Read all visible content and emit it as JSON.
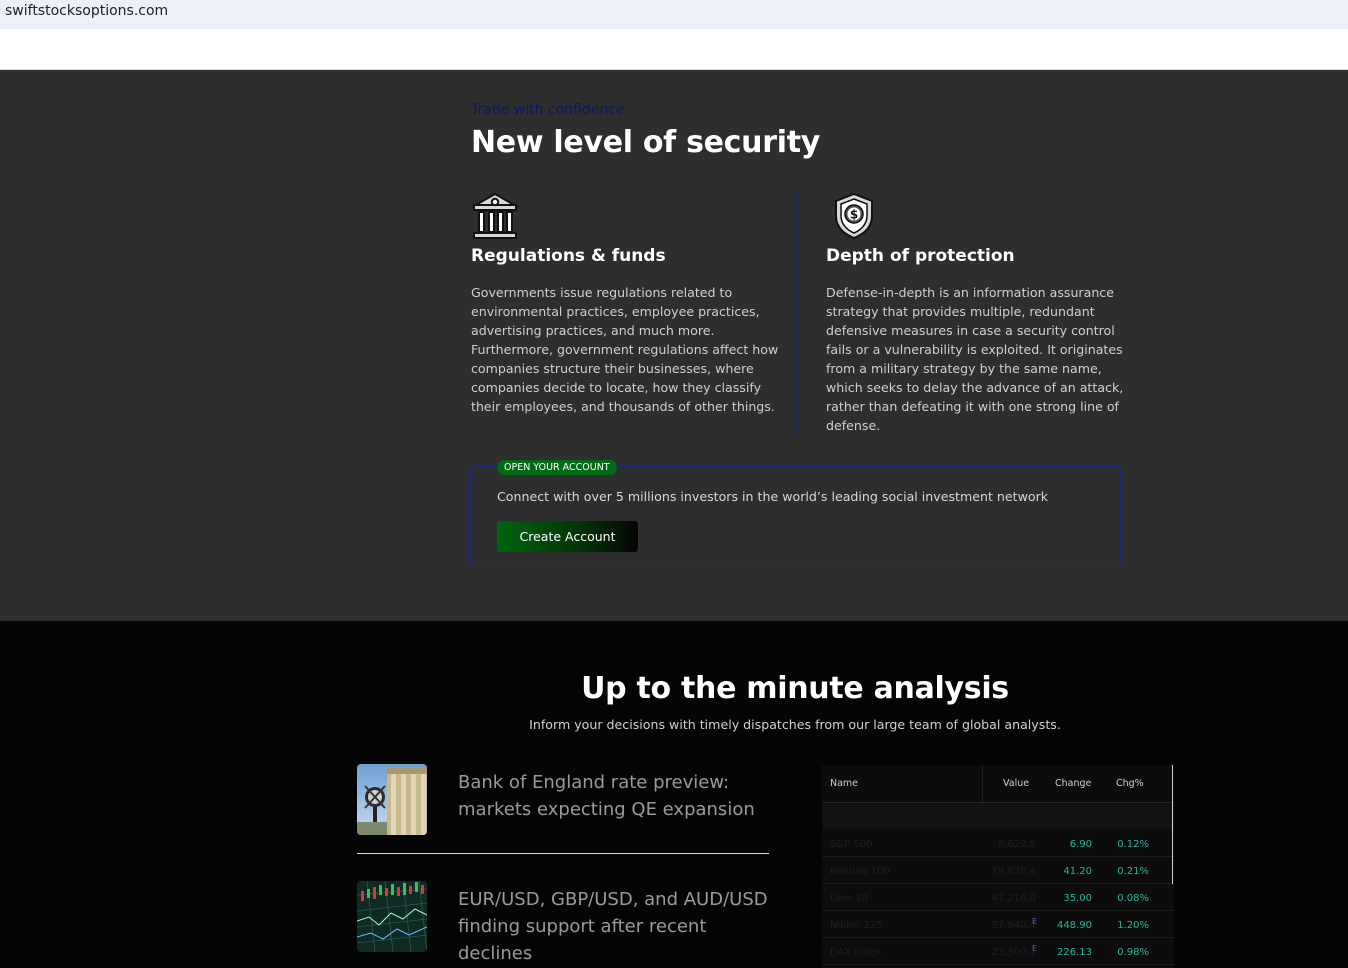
{
  "browser": {
    "url": "swiftstocksoptions.com"
  },
  "security": {
    "eyebrow": "Trade with confidence",
    "title": "New level of security",
    "features": [
      {
        "icon": "bank-building-icon",
        "title": "Regulations & funds",
        "text": "Governments issue regulations related to environmental practices, employee practices, advertising practices, and much more. Furthermore, government regulations affect how companies structure their businesses, where companies decide to locate, how they classify their employees, and thousands of other things."
      },
      {
        "icon": "shield-dollar-icon",
        "title": "Depth of protection",
        "text": "Defense-in-depth is an information assurance strategy that provides multiple, redundant defensive measures in case a security control fails or a vulnerability is exploited. It originates from a military strategy by the same name, which seeks to delay the advance of an attack, rather than defeating it with one strong line of defense."
      }
    ],
    "account": {
      "pill": "OPEN YOUR ACCOUNT",
      "text": "Connect with over 5 millions investors in the world’s leading social investment network",
      "button": "Create Account"
    }
  },
  "analysis": {
    "title": "Up to the minute analysis",
    "subtitle": "Inform your decisions with timely dispatches from our large team of global analysts.",
    "news": [
      {
        "title": "Bank of England rate preview: markets expecting QE expansion",
        "thumb": "bank-of-england-photo"
      },
      {
        "title": "EUR/USD, GBP/USD, and AUD/USD finding support after recent declines",
        "thumb": "forex-chart-photo"
      }
    ],
    "ticker": {
      "headers": {
        "name": "Name",
        "value": "Value",
        "change": "Change",
        "chg_pct": "Chg%"
      },
      "rows": [
        {
          "name": "S&P 500",
          "value": "5,622.5",
          "change": "6.90",
          "chg_pct": "0.12%",
          "marker": ""
        },
        {
          "name": "Nasdaq 100",
          "value": "19,820.4",
          "change": "41.20",
          "chg_pct": "0.21%",
          "marker": ""
        },
        {
          "name": "Dow 30",
          "value": "41,216.0",
          "change": "35.00",
          "chg_pct": "0.08%",
          "marker": ""
        },
        {
          "name": "Nikkei 225",
          "value": "37,840.4",
          "change": "448.90",
          "chg_pct": "1.20%",
          "marker": "E"
        },
        {
          "name": "DAX Index",
          "value": "23,300.1",
          "change": "226.13",
          "chg_pct": "0.98%",
          "marker": "E"
        }
      ]
    }
  }
}
